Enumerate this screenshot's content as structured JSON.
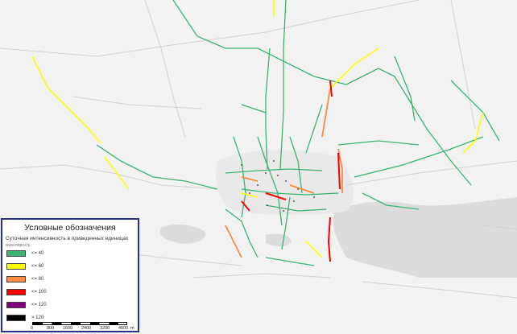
{
  "colors": {
    "map_background": "#f2f2f2",
    "water": "#dcdcdc",
    "major_road": "#d0d0d0",
    "level_le40": "#3cb371",
    "level_le60": "#ffff00",
    "level_le80": "#ff8c40",
    "level_le100": "#ff0000",
    "level_le120": "#800080",
    "level_gt120": "#000000",
    "legend_border": "#2a2f8f"
  },
  "legend": {
    "title": "Условные обозначения",
    "subtitle": "Суточная интенсивность в приведенных единицах",
    "site": "www.mtpru.ru",
    "items": [
      {
        "label": "<= 40",
        "color": "#3cb371"
      },
      {
        "label": "<= 60",
        "color": "#ffff00"
      },
      {
        "label": "<= 80",
        "color": "#ff8c40"
      },
      {
        "label": "<= 100",
        "color": "#ff0000"
      },
      {
        "label": "<= 120",
        "color": "#800080"
      },
      {
        "label": "> 120",
        "color": "#000000"
      }
    ]
  },
  "scale": {
    "ticks": [
      "0",
      "800",
      "1600",
      "2400",
      "3200",
      "4000"
    ],
    "unit": "m"
  }
}
